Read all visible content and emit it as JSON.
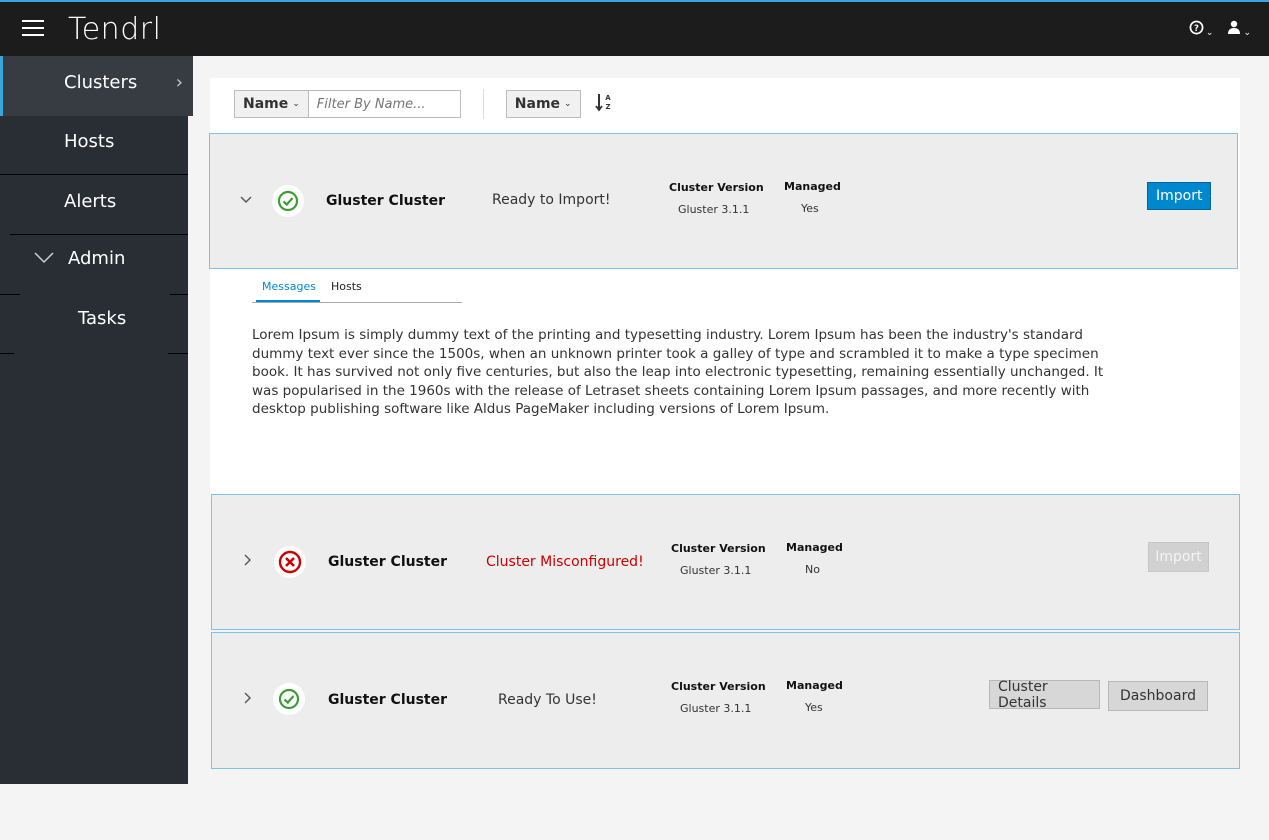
{
  "app": {
    "brand": "Tendrl"
  },
  "topbar": {
    "help_icon": "help-icon",
    "user_icon": "user-icon"
  },
  "sidebar": {
    "items": [
      {
        "label": "Clusters",
        "active": true
      },
      {
        "label": "Hosts"
      },
      {
        "label": "Alerts"
      },
      {
        "label": "Admin"
      },
      {
        "label": "Tasks"
      }
    ]
  },
  "toolbar": {
    "filter_field": "Name",
    "filter_placeholder": "Filter By Name...",
    "sort_field": "Name"
  },
  "clusters": [
    {
      "name": "Gluster Cluster",
      "status": "Ready to Import!",
      "status_kind": "ok",
      "version_label": "Cluster Version",
      "version": "Gluster 3.1.1",
      "managed_label": "Managed",
      "managed": "Yes",
      "expanded": true,
      "action": "Import"
    },
    {
      "name": "Gluster Cluster",
      "status": "Cluster Misconfigured!",
      "status_kind": "error",
      "version_label": "Cluster Version",
      "version": "Gluster 3.1.1",
      "managed_label": "Managed",
      "managed": "No",
      "action": "Import"
    },
    {
      "name": "Gluster Cluster",
      "status": "Ready To Use!",
      "status_kind": "ok",
      "version_label": "Cluster Version",
      "version": "Gluster 3.1.1",
      "managed_label": "Managed",
      "managed": "Yes",
      "actions": [
        "Cluster Details",
        "Dashboard"
      ]
    }
  ],
  "detail": {
    "tabs": [
      "Messages",
      "Hosts"
    ],
    "active_tab": "Messages",
    "message": "Lorem Ipsum is simply dummy text of the printing and typesetting industry. Lorem Ipsum has been the industry's standard dummy text ever since the 1500s, when an unknown printer took a galley of type and scrambled it to make a type specimen book. It has survived not only five centuries, but also the leap into electronic typesetting, remaining essentially unchanged. It was popularised in the 1960s with the release of Letraset sheets containing Lorem Ipsum passages, and more recently with desktop publishing software like Aldus PageMaker including versions of Lorem Ipsum."
  },
  "colors": {
    "accent": "#0088ce",
    "success": "#3f9c35",
    "danger": "#cc0000",
    "row_border": "#7dc3e8"
  }
}
